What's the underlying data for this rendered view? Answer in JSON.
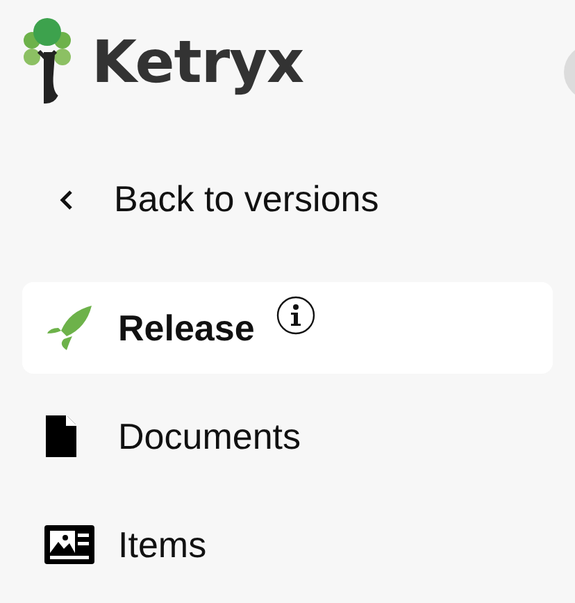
{
  "logo": {
    "text": "Ketryx"
  },
  "back_link": {
    "label": "Back to versions"
  },
  "nav": [
    {
      "label": "Release",
      "kind": "release",
      "selected": true,
      "info": true
    },
    {
      "label": "Documents",
      "kind": "documents",
      "selected": false,
      "info": false
    },
    {
      "label": "Items",
      "kind": "items",
      "selected": false,
      "info": false
    }
  ]
}
